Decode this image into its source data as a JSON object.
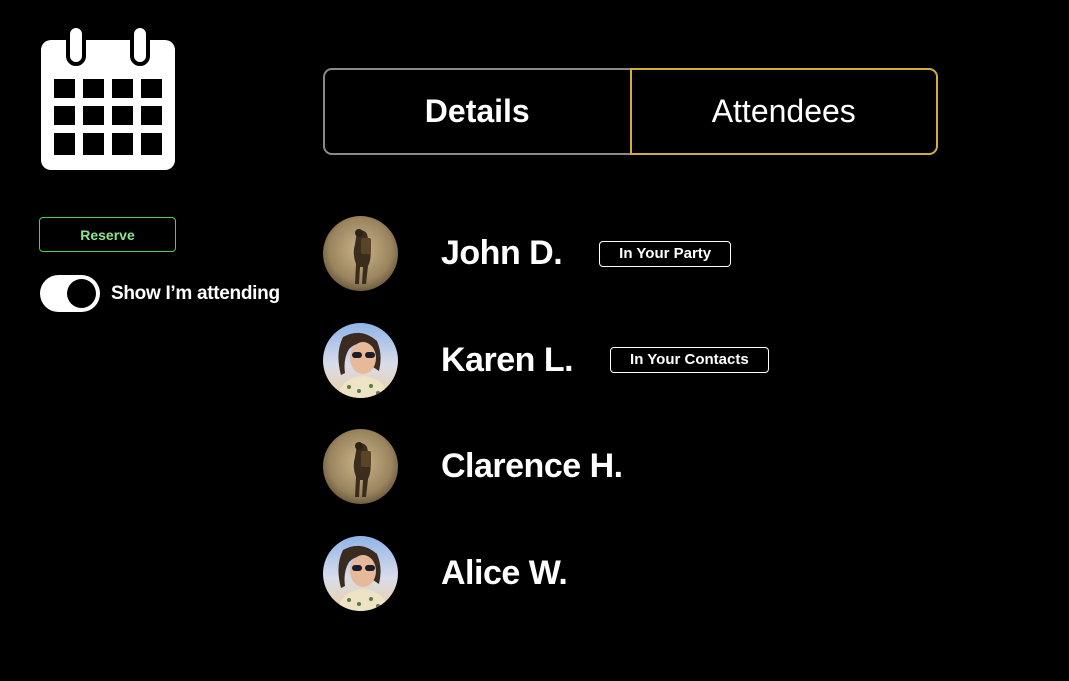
{
  "sidebar": {
    "calendar_icon": "calendar-icon",
    "reserve_label": "Reserve",
    "show_attending_label": "Show I’m attending",
    "show_attending_on": true
  },
  "tabs": [
    {
      "label": "Details",
      "active": false
    },
    {
      "label": "Attendees",
      "active": true
    }
  ],
  "attendees": [
    {
      "name": "John D.",
      "badge": "In Your Party",
      "avatar": "hiker-avatar"
    },
    {
      "name": "Karen L.",
      "badge": "In Your Contacts",
      "avatar": "woman-sunglasses-avatar"
    },
    {
      "name": "Clarence H.",
      "badge": "",
      "avatar": "hiker-avatar"
    },
    {
      "name": "Alice W.",
      "badge": "",
      "avatar": "woman-sunglasses-avatar"
    }
  ],
  "colors": {
    "background": "#000000",
    "reserve_border": "#4ccf57",
    "reserve_text": "#8de58f",
    "active_tab_border": "#d2ad3a",
    "inactive_tab_border": "#8a8a8a"
  }
}
